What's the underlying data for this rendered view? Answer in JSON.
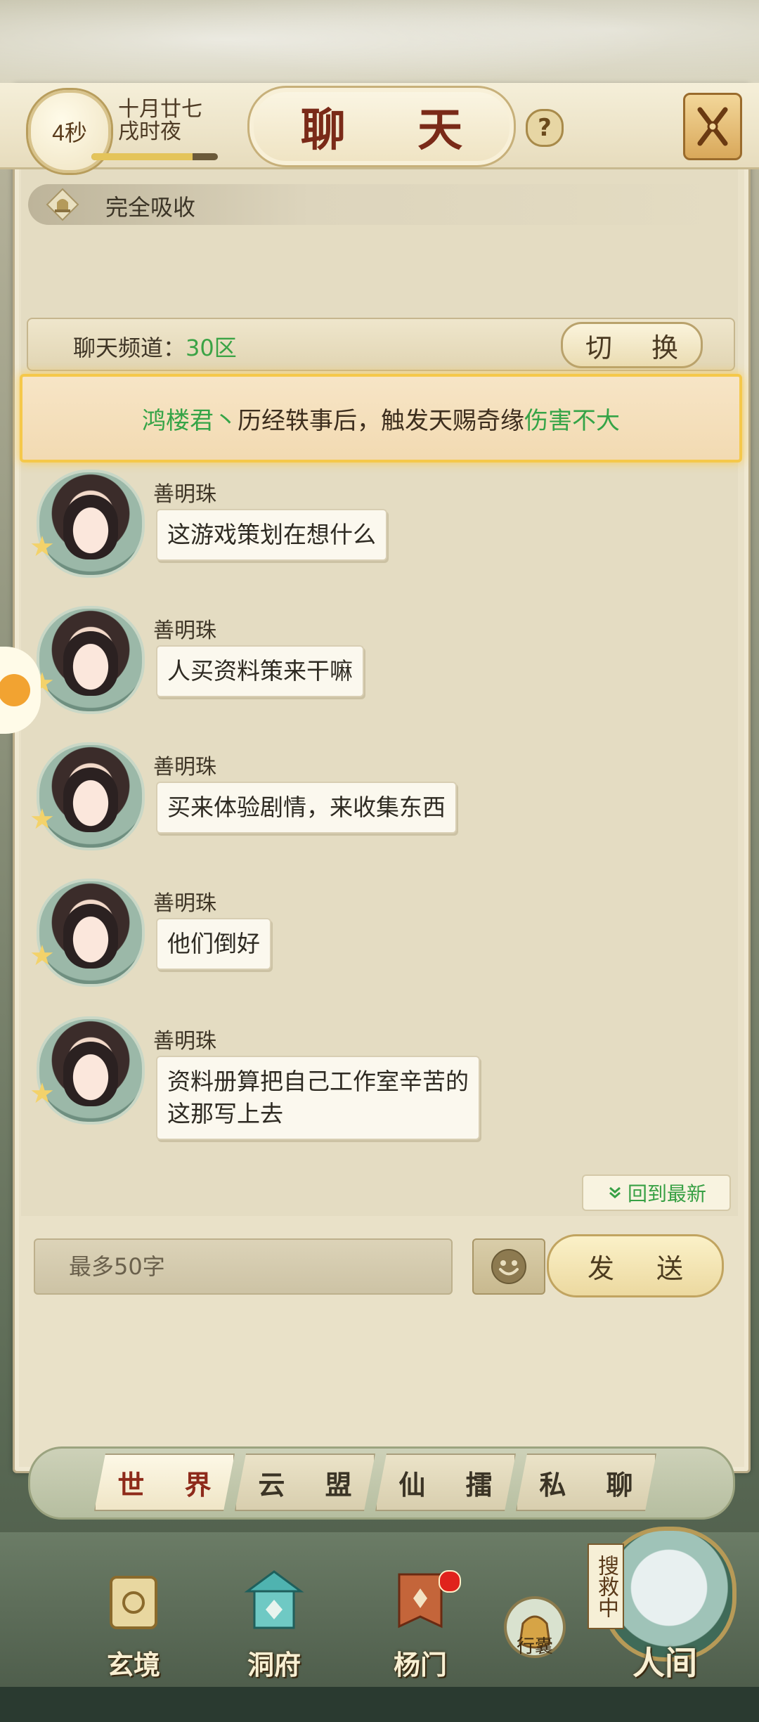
{
  "header": {
    "timer": "4秒",
    "date_line1": "十月廿七",
    "date_line2": "戌时夜",
    "progress": 0.8,
    "title": "聊 天",
    "help": "?"
  },
  "absorb": {
    "label": "完全吸收"
  },
  "channel": {
    "label": "聊天频道：",
    "value": "30区",
    "switch_label": "切 换"
  },
  "notice": {
    "name": "鸿楼君丶",
    "middle": "历经轶事后，触发天赐奇缘",
    "result": "伤害不大"
  },
  "messages": [
    {
      "sender": "善明珠",
      "text": "这游戏策划在想什么"
    },
    {
      "sender": "善明珠",
      "text": "人买资料策来干嘛"
    },
    {
      "sender": "善明珠",
      "text": "买来体验剧情，来收集东西"
    },
    {
      "sender": "善明珠",
      "text": "他们倒好"
    },
    {
      "sender": "善明珠",
      "text_line1": "资料册算把自己工作室辛苦的",
      "text_line2": "这那写上去"
    }
  ],
  "back_to_latest": "回到最新",
  "input": {
    "placeholder": "最多50字",
    "value": ""
  },
  "send_label": "发 送",
  "tabs": [
    "世 界",
    "云 盟",
    "仙 擂",
    "私 聊"
  ],
  "active_tab": "世 界",
  "bottom_nav": [
    {
      "label": "玄境",
      "icon": "scroll-icon"
    },
    {
      "label": "洞府",
      "icon": "pavilion-icon"
    },
    {
      "label": "杨门",
      "icon": "banner-icon"
    },
    {
      "label": "行囊",
      "icon": "bag-icon"
    },
    {
      "label": "人间",
      "icon": "landscape-icon"
    }
  ],
  "search_tag": "搜救中",
  "colors": {
    "accent_green": "#35a447",
    "title_red": "#7a2a18",
    "notice_gold": "#f5c84a"
  }
}
